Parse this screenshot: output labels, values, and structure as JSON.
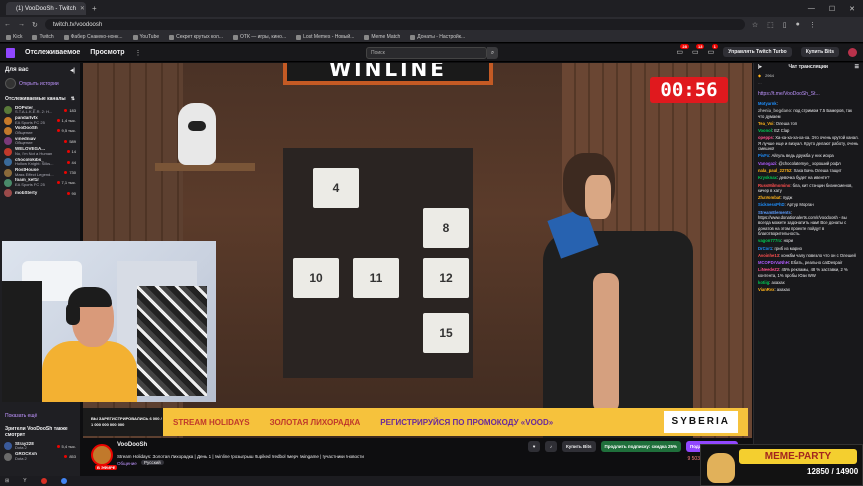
{
  "browser": {
    "tab_title": "(1) VooDooSh - Twitch",
    "url": "twitch.tv/voodoosh",
    "bookmarks": [
      "Kick",
      "Twitch",
      "Фабер Снакеко-нонк...",
      "YouTube",
      "Секрет крутых кол...",
      "ОТК — игры, кино...",
      "Lost Memes - Новый...",
      "Meme Match",
      "Донаты - Настройк..."
    ]
  },
  "topnav": {
    "following": "Отслеживаемое",
    "browse": "Просмотр",
    "search_placeholder": "Поиск",
    "notif_1": "28",
    "notif_2": "13",
    "notif_3": "1",
    "turbo": "Управлять Twitch Turbo",
    "bits": "Купить Bits"
  },
  "sidebar": {
    "for_you": "Для вас",
    "history": "Открыть истории",
    "followed": "Отслеживаемые каналы",
    "channels": [
      {
        "name": "DOPster_",
        "game": "S.T.A.L.K.E.R. 2: H...",
        "viewers": "183",
        "color": "#5a7a3a"
      },
      {
        "name": "pandarlvfx",
        "game": "EA Sports FC 25",
        "viewers": "1,4 тыс.",
        "color": "#c77a2a"
      },
      {
        "name": "VooDooSh",
        "game": "Общение",
        "viewers": "9,5 тыс.",
        "color": "#c1792b"
      },
      {
        "name": "vinedniav",
        "game": "Общение",
        "viewers": "589",
        "color": "#7a3a7a"
      },
      {
        "name": "WELOVEGA...",
        "game": "No, I'm Not a Human",
        "viewers": "14",
        "color": "#c0392b"
      },
      {
        "name": "chocolokibs_",
        "game": "Hollow Knight: Silks...",
        "viewers": "44",
        "color": "#3a6a9a"
      },
      {
        "name": "RostHouse",
        "game": "Mass Effect Legend...",
        "viewers": "730",
        "color": "#8a6a3a"
      },
      {
        "name": "foam_kef1r",
        "game": "EA Sports FC 25",
        "viewers": "7,1 тыс.",
        "color": "#4a8a6a"
      },
      {
        "name": "mobSterty",
        "game": "",
        "viewers": "90",
        "color": "#9a4a4a"
      }
    ],
    "show_more": "Показать ещё",
    "also_watching": "Зрители VooDooSh также смотрят",
    "recs": [
      {
        "name": "Stray228",
        "game": "Dota 2",
        "viewers": "5,4 тыс.",
        "color": "#3a5a9a"
      },
      {
        "name": "GROCKsh",
        "game": "Dota 2",
        "viewers": "853",
        "color": "#6a6a6a"
      }
    ]
  },
  "video": {
    "sign": "WINLINE",
    "timer": "00:56",
    "cards": [
      "4",
      "8",
      "10",
      "11",
      "12",
      "15"
    ]
  },
  "banner": {
    "left": "ВЫ ЗАРЕГИСТРИРОВАЛИСЬ 6 000 / 1 000 000 000 000",
    "stream_holidays": "STREAM HOLIDAYS",
    "gold": "ЗОЛОТАЯ ЛИХОРАДКА",
    "register": "РЕГИСТРИРУЙСЯ ПО ПРОМОКОДУ «VOOD»",
    "syberia": "SYBERIA"
  },
  "info": {
    "name": "VooDooSh",
    "title": "Stream Holidays: Золотая Лихорадка | День 1 | !winline !розыгрыш !tupiked !redbol !мерч !wingame | !участники !новости",
    "category": "Общение",
    "tag": "Русский",
    "live": "В ЭФИРЕ",
    "buy_bits": "Купить Bits",
    "extend_sub": "Продлить подписку: скидка 25%",
    "gift_sub": "Подарить подписку",
    "viewers": "9 503",
    "uptime": "0:24:22"
  },
  "chat": {
    "title": "Чат трансляции",
    "pinned_count": "2964",
    "link": "https://t.me/VooDooSh_St...",
    "messages": [
      {
        "user": "Motyarnk",
        "text": "",
        "color": "#1e90ff"
      },
      {
        "user": "zhenia_bogdano",
        "text": "под стримом 7.5 Бамеров, так что думаем",
        "color": "#aaaaaa"
      },
      {
        "user": "Tea_Voi",
        "text": "Олеша топ",
        "color": "#ffb31a"
      },
      {
        "user": "Voonol",
        "text": "EZ Clap",
        "color": "#00c853"
      },
      {
        "user": "opepps",
        "text": "Ха-ха-ха-ха-ха-ха. Это очень крутой канал. Я лучше еще и визуал. Круто делают работу, очень смешно!",
        "color": "#ff4f8b"
      },
      {
        "user": "PivFx",
        "text": "Айгуль ведь дружба у них искра",
        "color": "#1e90ff"
      },
      {
        "user": "Vanogazi",
        "text": "@chocolatemye_ хороший рофл",
        "color": "#b05cff"
      },
      {
        "user": "nala_paul_22752",
        "text": "Хаха Бачь Олеша тащит",
        "color": "#ffb31a"
      },
      {
        "user": "Krysknax",
        "text": "девочка будет на ивенте?",
        "color": "#00c853"
      },
      {
        "user": "RussMilmomino",
        "text": "бла, кит стэнцин бизнесменов, кичер в хату",
        "color": "#ff4f4f"
      },
      {
        "user": "ZhaVombat",
        "text": "пудж",
        "color": "#ffb31a"
      },
      {
        "user": "SicknessPhD",
        "text": "Артур Морган",
        "color": "#1e90ff"
      },
      {
        "user": "StreamElements",
        "text": "https://www.donationalerts.com/r/voodoosh - вы всегда можете задонатить нам! Все донаты с донатов на этом проекте пойдут в благотворительность.",
        "color": "#5c9dff"
      },
      {
        "user": "vagon777rx",
        "text": "нори",
        "color": "#00c853"
      },
      {
        "user": "DrCor1",
        "text": "гриб из марио",
        "color": "#1e90ff"
      },
      {
        "user": "Avoinhe13",
        "text": "конкбм чалу повезло что он с Олешей",
        "color": "#ff4f4f"
      },
      {
        "user": "MCOPDrVaNhH",
        "text": "Ебать, реально catDespair",
        "color": "#b05cff"
      },
      {
        "user": "LiNeedeZ2",
        "text": "45% рекламы, 48 % заставки, 2 % контента, 1% пробы Юзи WW",
        "color": "#ff4f8b"
      },
      {
        "user": "kotiig",
        "text": "ахахах",
        "color": "#00c853"
      },
      {
        "user": "VianRvx",
        "text": "ахахах",
        "color": "#ffb31a"
      }
    ],
    "input_placeholder": "Медленный режим"
  },
  "meme": {
    "label": "MEME-PARTY",
    "count": "12850 / 14900"
  },
  "taskbar": {
    "items": [
      "Y",
      "Ярлык",
      "Chrome"
    ]
  }
}
